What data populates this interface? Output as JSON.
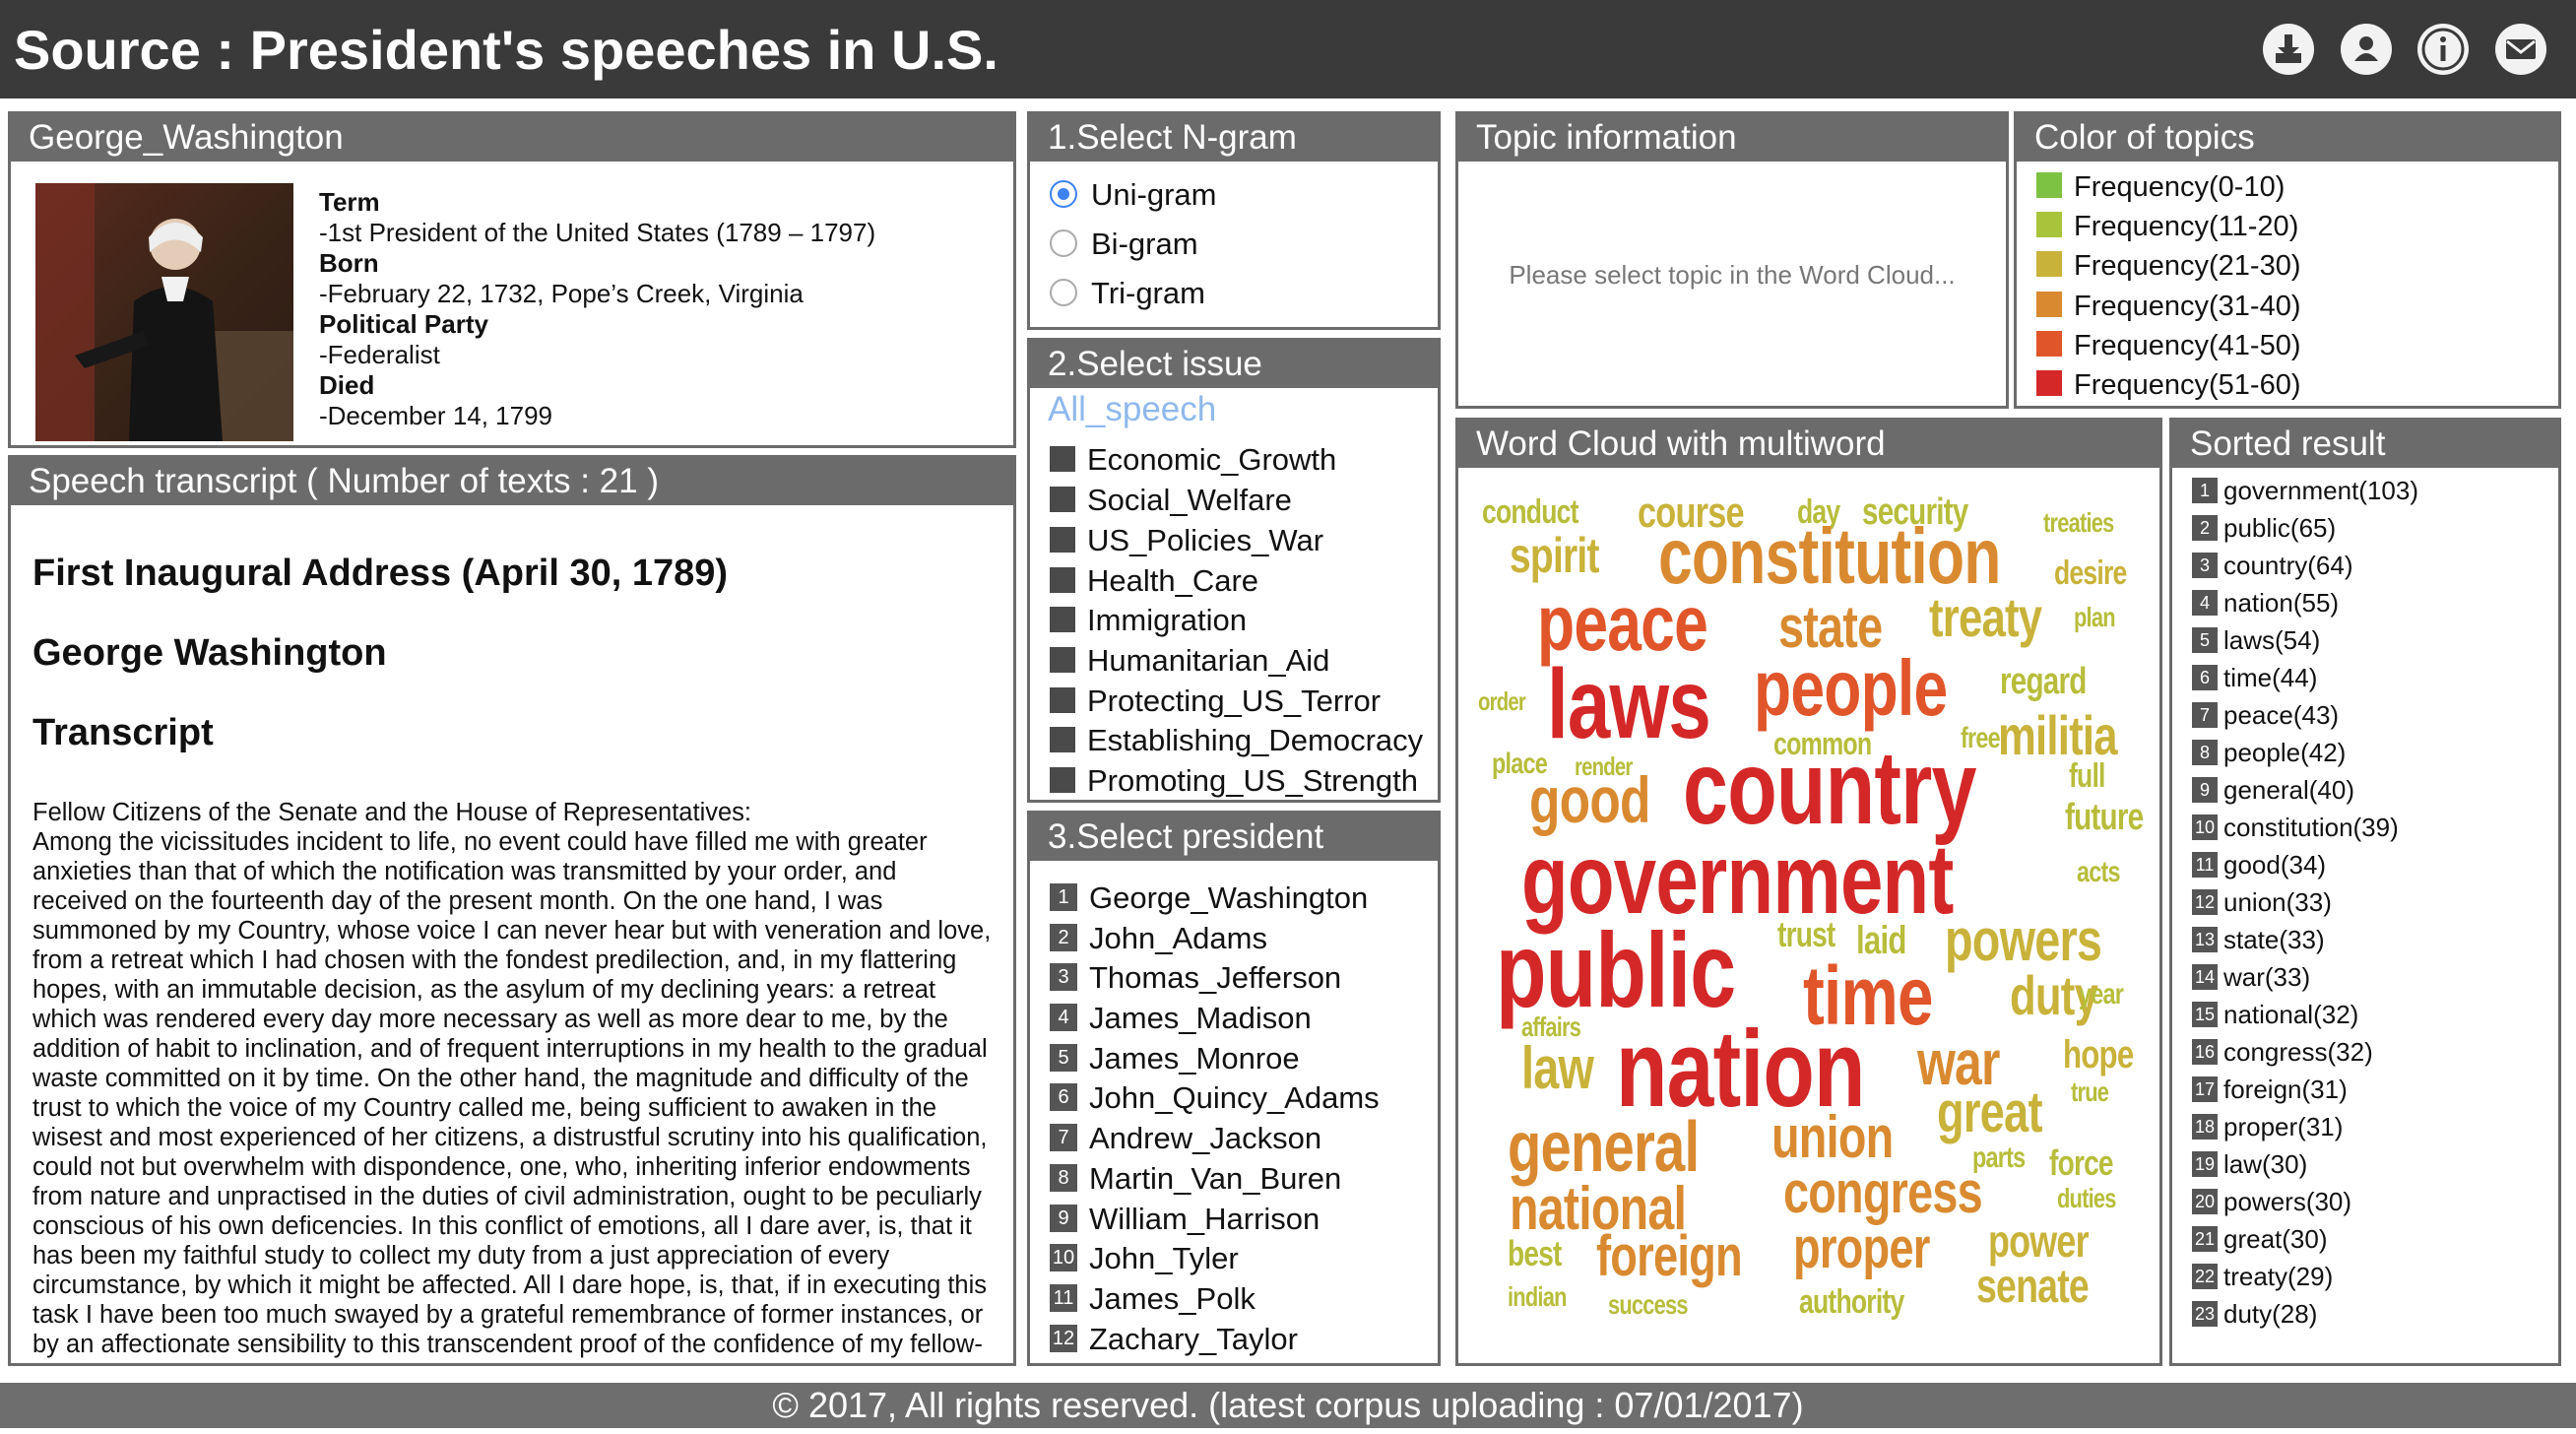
{
  "header": {
    "title": "Source : President's speeches in U.S.",
    "icons": [
      "download-icon",
      "user-icon",
      "info-icon",
      "mail-icon"
    ]
  },
  "profile": {
    "title": "George_Washington",
    "term_label": "Term",
    "term": "-1st President of the United States (1789 – 1797)",
    "born_label": "Born",
    "born": "-February 22, 1732, Pope’s Creek, Virginia",
    "party_label": "Political Party",
    "party": "-Federalist",
    "died_label": "Died",
    "died": "-December 14, 1799"
  },
  "transcript": {
    "title": "Speech transcript ( Number of texts : 21 )",
    "speech_title": "First Inaugural Address (April 30, 1789)",
    "author": "George Washington",
    "heading": "Transcript",
    "salutation": "Fellow Citizens of the Senate and the House of Representatives:",
    "text": "Among the vicissitudes incident to life, no event could have filled me with greater anxieties than that of which the notification was transmitted by your order, and received on the fourteenth day of the present month. On the one hand, I was summoned by my Country, whose voice I can never hear but with veneration and love, from a retreat which I had chosen with the fondest predilection, and, in my flattering hopes, with an immutable decision, as the asylum of my declining years: a retreat which was rendered every day more necessary as well as more dear to me, by the addition of habit to inclination, and of frequent interruptions in my health to the gradual waste committed on it by time. On the other hand, the magnitude and difficulty of the trust to which the voice of my Country called me, being sufficient to awaken in the wisest and most experienced of her citizens, a distrustful scrutiny into his qualification, could not but overwhelm with dispondence, one, who, inheriting inferior endowments from nature and unpractised in the duties of civil administration, ought to be peculiarly conscious of his own deficencies. In this conflict of emotions, all I dare aver, is, that it has been my faithful study to collect my duty from a just appreciation of every circumstance, by which it might be affected. All I dare hope, is, that, if in executing this task I have been too much swayed by a grateful remembrance of former instances, or by an affectionate sensibility to this transcendent proof of the confidence of my fellow-citizens; and have thence too little consulted my incapacity as well as disinclination for the weighty and untried cares before me; my error will be palliated by the motives which mislead me."
  },
  "ngram": {
    "title": "1.Select N-gram",
    "options": [
      "Uni-gram",
      "Bi-gram",
      "Tri-gram"
    ],
    "selected": "Uni-gram"
  },
  "issue": {
    "title": "2.Select issue",
    "all_label": "All_speech",
    "options": [
      "Economic_Growth",
      "Social_Welfare",
      "US_Policies_War",
      "Health_Care",
      "Immigration",
      "Humanitarian_Aid",
      "Protecting_US_Terror",
      "Establishing_Democracy",
      "Promoting_US_Strength"
    ]
  },
  "president": {
    "title": "3.Select president",
    "options": [
      {
        "num": "1",
        "name": "George_Washington"
      },
      {
        "num": "2",
        "name": "John_Adams"
      },
      {
        "num": "3",
        "name": "Thomas_Jefferson"
      },
      {
        "num": "4",
        "name": "James_Madison"
      },
      {
        "num": "5",
        "name": "James_Monroe"
      },
      {
        "num": "6",
        "name": "John_Quincy_Adams"
      },
      {
        "num": "7",
        "name": "Andrew_Jackson"
      },
      {
        "num": "8",
        "name": "Martin_Van_Buren"
      },
      {
        "num": "9",
        "name": "William_Harrison"
      },
      {
        "num": "10",
        "name": "John_Tyler"
      },
      {
        "num": "11",
        "name": "James_Polk"
      },
      {
        "num": "12",
        "name": "Zachary_Taylor"
      }
    ]
  },
  "topic": {
    "title": "Topic information",
    "placeholder": "Please select topic in the Word Cloud..."
  },
  "legend": {
    "title": "Color of topics",
    "items": [
      {
        "label": "Frequency(0-10)",
        "color": "#7dc242"
      },
      {
        "label": "Frequency(11-20)",
        "color": "#a9c43a"
      },
      {
        "label": "Frequency(21-30)",
        "color": "#c9b23a"
      },
      {
        "label": "Frequency(31-40)",
        "color": "#d98a30"
      },
      {
        "label": "Frequency(41-50)",
        "color": "#e0552a"
      },
      {
        "label": "Frequency(51-60)",
        "color": "#d42828"
      }
    ]
  },
  "wordcloud": {
    "title": "Word Cloud with multiword",
    "words": [
      {
        "text": "conduct",
        "color": "#b7bd3a"
      },
      {
        "text": "course",
        "color": "#c9b23a"
      },
      {
        "text": "day",
        "color": "#b7bd3a"
      },
      {
        "text": "security",
        "color": "#b7bd3a"
      },
      {
        "text": "treaties",
        "color": "#b7bd3a"
      },
      {
        "text": "spirit",
        "color": "#c9b23a"
      },
      {
        "text": "constitution",
        "color": "#d98a30"
      },
      {
        "text": "desire",
        "color": "#c9b23a"
      },
      {
        "text": "peace",
        "color": "#e0552a"
      },
      {
        "text": "state",
        "color": "#d98a30"
      },
      {
        "text": "treaty",
        "color": "#c9b23a"
      },
      {
        "text": "plan",
        "color": "#b7bd3a"
      },
      {
        "text": "order",
        "color": "#b7bd3a"
      },
      {
        "text": "laws",
        "color": "#d42828"
      },
      {
        "text": "people",
        "color": "#e0552a"
      },
      {
        "text": "regard",
        "color": "#b7bd3a"
      },
      {
        "text": "common",
        "color": "#b7bd3a"
      },
      {
        "text": "free",
        "color": "#b7bd3a"
      },
      {
        "text": "militia",
        "color": "#c9b23a"
      },
      {
        "text": "place",
        "color": "#b7bd3a"
      },
      {
        "text": "render",
        "color": "#b7bd3a"
      },
      {
        "text": "full",
        "color": "#b7bd3a"
      },
      {
        "text": "good",
        "color": "#d98a30"
      },
      {
        "text": "country",
        "color": "#d42828"
      },
      {
        "text": "future",
        "color": "#b7bd3a"
      },
      {
        "text": "government",
        "color": "#d42828"
      },
      {
        "text": "acts",
        "color": "#b7bd3a"
      },
      {
        "text": "public",
        "color": "#d42828"
      },
      {
        "text": "trust",
        "color": "#b7bd3a"
      },
      {
        "text": "laid",
        "color": "#b7bd3a"
      },
      {
        "text": "powers",
        "color": "#c9b23a"
      },
      {
        "text": "time",
        "color": "#e0552a"
      },
      {
        "text": "duty",
        "color": "#c9b23a"
      },
      {
        "text": "year",
        "color": "#b7bd3a"
      },
      {
        "text": "affairs",
        "color": "#b7bd3a"
      },
      {
        "text": "law",
        "color": "#c9b23a"
      },
      {
        "text": "nation",
        "color": "#d42828"
      },
      {
        "text": "war",
        "color": "#d98a30"
      },
      {
        "text": "hope",
        "color": "#c9b23a"
      },
      {
        "text": "true",
        "color": "#b7bd3a"
      },
      {
        "text": "general",
        "color": "#d98a30"
      },
      {
        "text": "union",
        "color": "#d98a30"
      },
      {
        "text": "great",
        "color": "#c9b23a"
      },
      {
        "text": "parts",
        "color": "#b7bd3a"
      },
      {
        "text": "force",
        "color": "#b7bd3a"
      },
      {
        "text": "national",
        "color": "#d98a30"
      },
      {
        "text": "congress",
        "color": "#d98a30"
      },
      {
        "text": "duties",
        "color": "#b7bd3a"
      },
      {
        "text": "best",
        "color": "#b7bd3a"
      },
      {
        "text": "foreign",
        "color": "#d98a30"
      },
      {
        "text": "proper",
        "color": "#d98a30"
      },
      {
        "text": "power",
        "color": "#c9b23a"
      },
      {
        "text": "indian",
        "color": "#b7bd3a"
      },
      {
        "text": "success",
        "color": "#b7bd3a"
      },
      {
        "text": "authority",
        "color": "#b7bd3a"
      },
      {
        "text": "senate",
        "color": "#c9b23a"
      }
    ]
  },
  "sorted": {
    "title": "Sorted result",
    "items": [
      {
        "num": "1",
        "label": "government(103)"
      },
      {
        "num": "2",
        "label": "public(65)"
      },
      {
        "num": "3",
        "label": "country(64)"
      },
      {
        "num": "4",
        "label": "nation(55)"
      },
      {
        "num": "5",
        "label": "laws(54)"
      },
      {
        "num": "6",
        "label": "time(44)"
      },
      {
        "num": "7",
        "label": "peace(43)"
      },
      {
        "num": "8",
        "label": "people(42)"
      },
      {
        "num": "9",
        "label": "general(40)"
      },
      {
        "num": "10",
        "label": "constitution(39)"
      },
      {
        "num": "11",
        "label": "good(34)"
      },
      {
        "num": "12",
        "label": "union(33)"
      },
      {
        "num": "13",
        "label": "state(33)"
      },
      {
        "num": "14",
        "label": "war(33)"
      },
      {
        "num": "15",
        "label": "national(32)"
      },
      {
        "num": "16",
        "label": "congress(32)"
      },
      {
        "num": "17",
        "label": "foreign(31)"
      },
      {
        "num": "18",
        "label": "proper(31)"
      },
      {
        "num": "19",
        "label": "law(30)"
      },
      {
        "num": "20",
        "label": "powers(30)"
      },
      {
        "num": "21",
        "label": "great(30)"
      },
      {
        "num": "22",
        "label": "treaty(29)"
      },
      {
        "num": "23",
        "label": "duty(28)"
      }
    ]
  },
  "footer": {
    "text": "© 2017, All rights reserved. (latest corpus uploading : 07/01/2017)"
  }
}
